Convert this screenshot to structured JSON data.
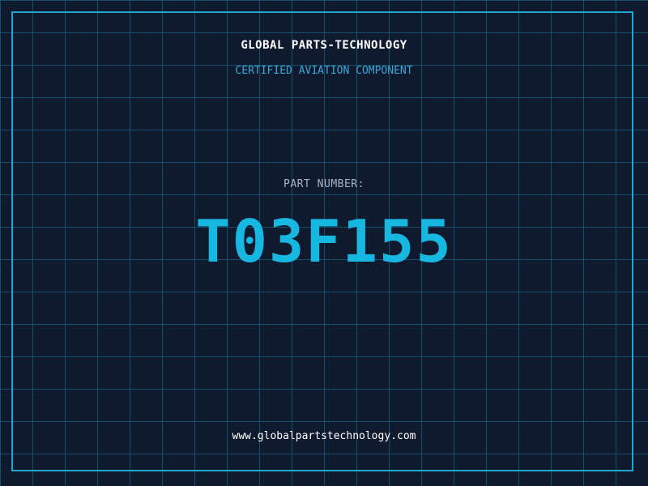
{
  "header": {
    "company": "GLOBAL PARTS-TECHNOLOGY",
    "tagline": "CERTIFIED AVIATION COMPONENT"
  },
  "part": {
    "label": "PART NUMBER:",
    "number": "T03F155"
  },
  "footer": {
    "website": "www.globalpartstechnology.com"
  },
  "colors": {
    "background": "#0f1a2e",
    "grid": "#1c7896",
    "frame": "#22a6d0",
    "accent": "#16b7e0",
    "tagline": "#3aa7d8",
    "label": "#a9b4c2"
  }
}
